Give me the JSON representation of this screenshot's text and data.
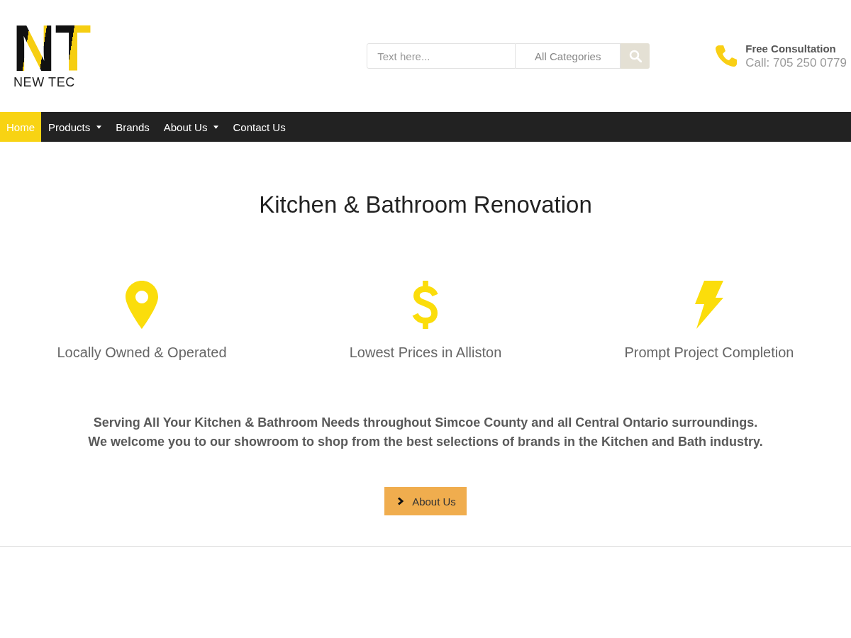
{
  "header": {
    "logo": {
      "monogram": "NT",
      "wordmark": "NEW TEC"
    },
    "search": {
      "placeholder": "Text here...",
      "category": "All Categories"
    },
    "contact": {
      "title": "Free Consultation",
      "phone": "Call: 705 250 0779"
    }
  },
  "nav": [
    {
      "label": "Home",
      "selected": true,
      "has_dropdown": false
    },
    {
      "label": "Products",
      "selected": false,
      "has_dropdown": true
    },
    {
      "label": "Brands",
      "selected": false,
      "has_dropdown": false
    },
    {
      "label": "About Us",
      "selected": false,
      "has_dropdown": true
    },
    {
      "label": "Contact Us",
      "selected": false,
      "has_dropdown": false
    }
  ],
  "heading": "Kitchen & Bathroom Renovation",
  "features": [
    {
      "kind": "pin",
      "label": "Locally Owned & Operated"
    },
    {
      "kind": "dollar",
      "label": "Lowest Prices in Alliston"
    },
    {
      "kind": "bolt",
      "label": "Prompt Project Completion"
    }
  ],
  "intro": [
    "Serving All Your Kitchen & Bathroom Needs throughout Simcoe County and all Central Ontario surroundings.",
    "We welcome you to our showroom to shop from the best selections of brands in the Kitchen and Bath industry."
  ],
  "cta": {
    "label": "About Us"
  }
}
